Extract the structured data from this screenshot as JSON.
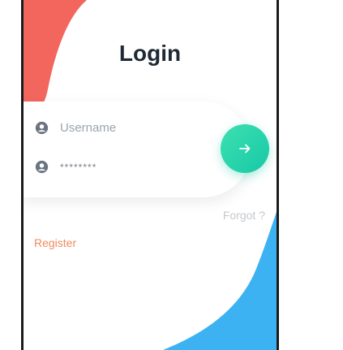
{
  "screen": {
    "title": "Login",
    "username_placeholder": "Username",
    "password_value": "********",
    "forgot_label": "Forgot ?",
    "register_label": "Register"
  },
  "colors": {
    "accent_red": "#f2665e",
    "accent_teal": "#1fd6ad",
    "accent_blue": "#3db2f2",
    "register_orange": "#ef8a5a"
  },
  "icons": {
    "user": "person-circle-icon",
    "submit": "arrow-right-icon"
  }
}
